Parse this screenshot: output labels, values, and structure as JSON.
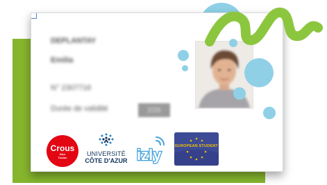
{
  "card": {
    "name_blurred": "DEPLANTAY",
    "firstname_blurred": "Emilia",
    "number_blurred": "N° 2307716",
    "validity_label_blurred": "Durée de validité",
    "validity_value_blurred": "2/26"
  },
  "logos": {
    "crous_name": "Crous",
    "crous_sub1": "Nice",
    "crous_sub2": "Toulon",
    "university_line1": "UNIVERSITÉ",
    "university_line2": "CÔTE D'AZUR",
    "izly_name": "izly",
    "esc_name": "EUROPEAN STUDENT"
  },
  "colors": {
    "green": "#86b52d",
    "squiggle": "#8cc63f",
    "bubble": "#8fd0e6",
    "crous_red": "#e30613",
    "izly_blue": "#3ea1db",
    "esc_blue": "#3d4a96",
    "esc_yellow": "#f2c200"
  }
}
